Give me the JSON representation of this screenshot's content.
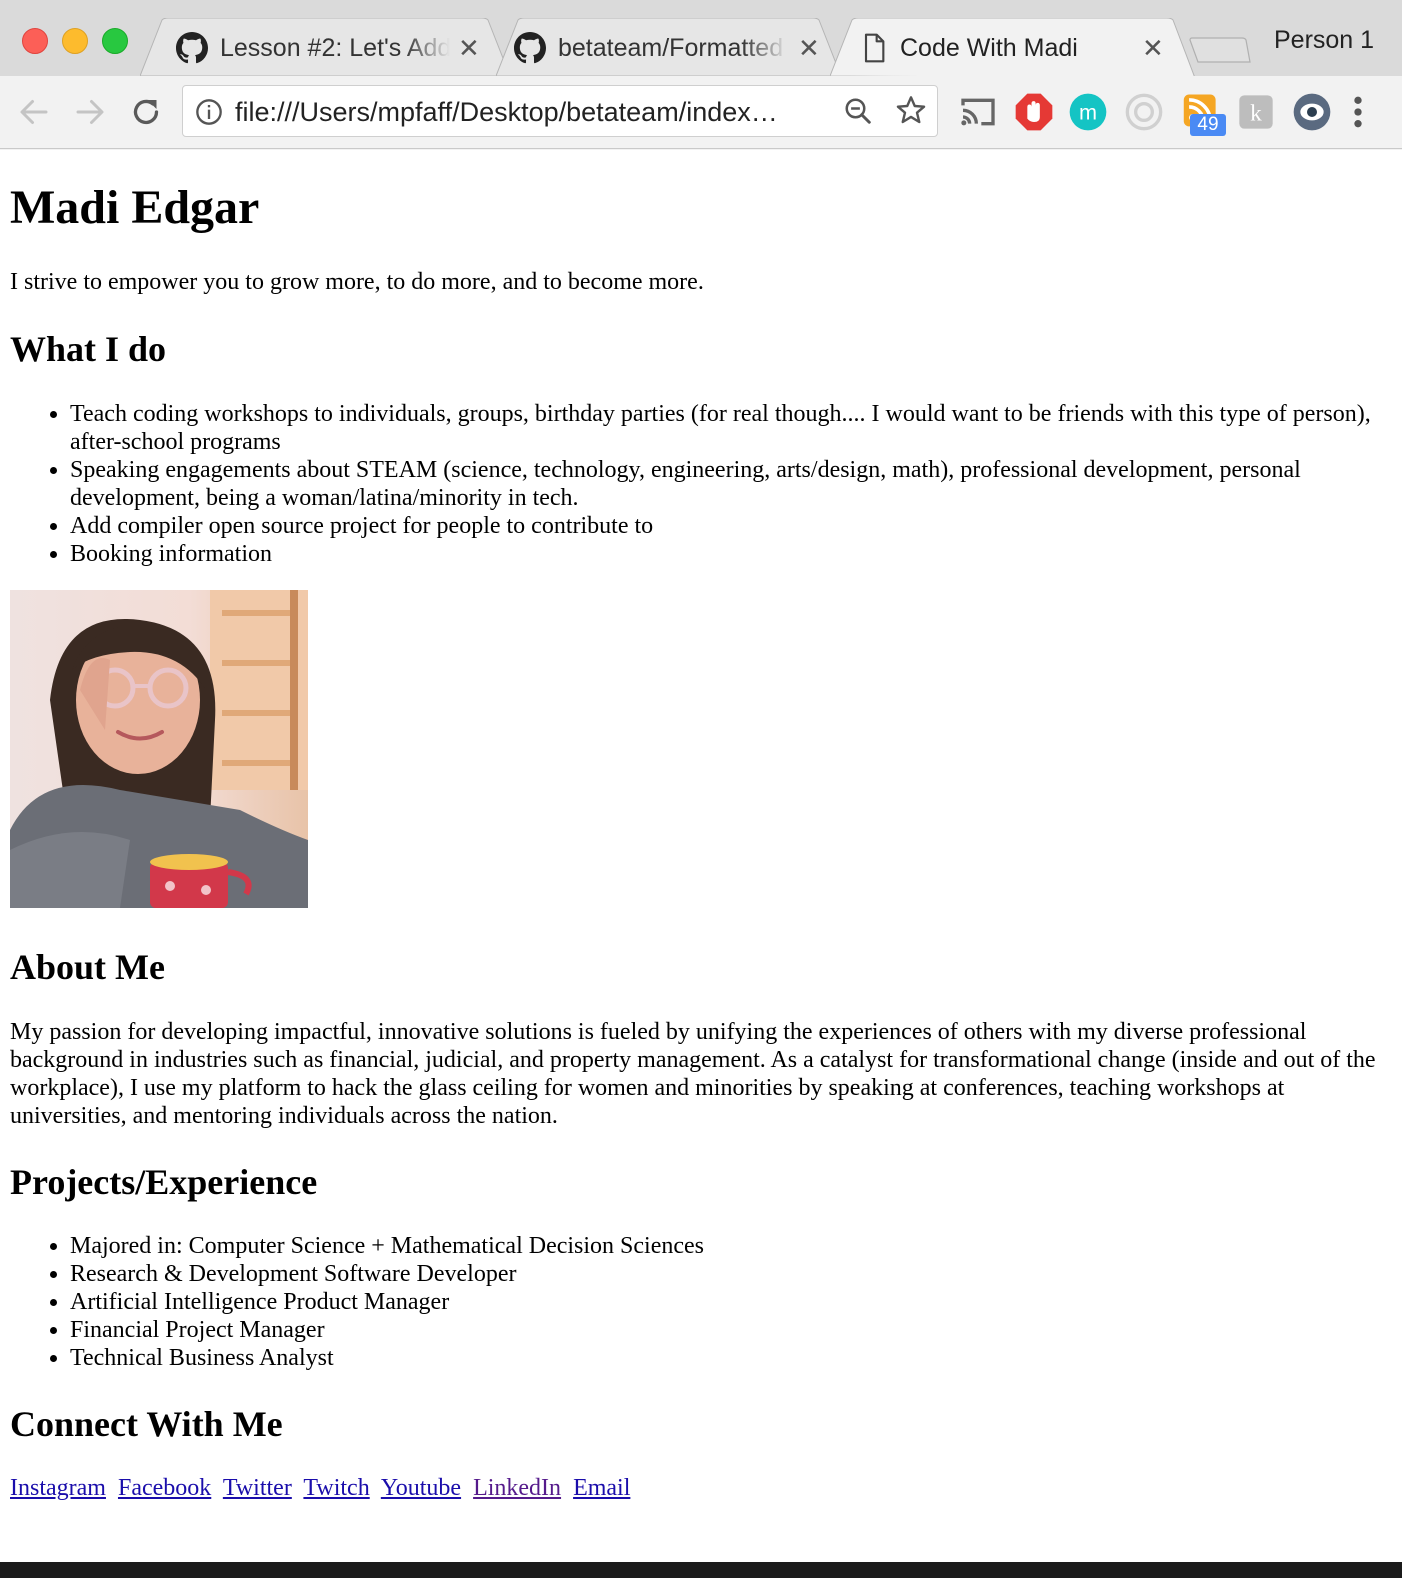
{
  "browser": {
    "tabs": [
      {
        "title": "Lesson #2: Let's Add",
        "favicon": "github-icon"
      },
      {
        "title": "betateam/Formatted",
        "favicon": "github-icon"
      },
      {
        "title": "Code With Madi",
        "favicon": "document-icon"
      }
    ],
    "active_tab": 2,
    "profile_name": "Person 1",
    "url": "file:///Users/mpfaff/Desktop/betateam/index…",
    "extension_badge": "49",
    "extension_icons": [
      "cast-icon",
      "adblock-icon",
      "m-extension-icon",
      "circle-extension-icon",
      "rss-feed-icon",
      "kindle-icon",
      "eye-extension-icon",
      "menu-dots-icon"
    ],
    "colors": {
      "adblock": "#e53935",
      "m_extension": "#14c4c4",
      "rss": "#f5a623",
      "badge": "#4a8af4"
    }
  },
  "page": {
    "name": "Madi Edgar",
    "tagline": "I strive to empower you to grow more, to do more, and to become more.",
    "what_i_do": {
      "heading": "What I do",
      "items": [
        "Teach coding workshops to individuals, groups, birthday parties (for real though.... I would want to be friends with this type of person), after-school programs",
        "Speaking engagements about STEAM (science, technology, engineering, arts/design, math), professional development, personal development, being a woman/latina/minority in tech.",
        "Add compiler open source project for people to contribute to",
        "Booking information"
      ]
    },
    "about": {
      "heading": "About Me",
      "text": "My passion for developing impactful, innovative solutions is fueled by unifying the experiences of others with my diverse professional background in industries such as financial, judicial, and property management. As a catalyst for transformational change (inside and out of the workplace), I use my platform to hack the glass ceiling for women and minorities by speaking at conferences, teaching workshops at universities, and mentoring individuals across the nation."
    },
    "projects": {
      "heading": "Projects/Experience",
      "items": [
        "Majored in: Computer Science + Mathematical Decision Sciences",
        "Research & Development Software Developer",
        "Artificial Intelligence Product Manager",
        "Financial Project Manager",
        "Technical Business Analyst"
      ]
    },
    "connect": {
      "heading": "Connect With Me",
      "links": [
        "Instagram",
        "Facebook",
        "Twitter",
        "Twitch",
        "Youtube",
        "LinkedIn",
        "Email"
      ]
    }
  }
}
